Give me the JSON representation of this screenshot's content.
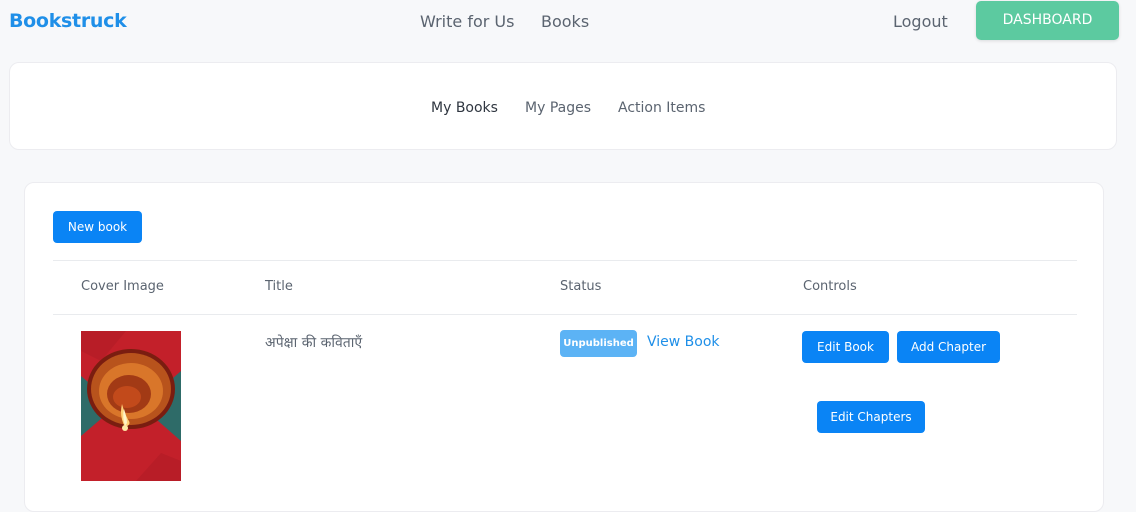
{
  "brand": "Bookstruck",
  "nav": {
    "write_for_us": "Write for Us",
    "books": "Books",
    "logout": "Logout",
    "dashboard": "DASHBOARD"
  },
  "tabs": [
    {
      "label": "My Books",
      "active": true
    },
    {
      "label": "My Pages",
      "active": false
    },
    {
      "label": "Action Items",
      "active": false
    }
  ],
  "new_book_label": "New book",
  "table": {
    "headers": [
      "Cover Image",
      "Title",
      "Status",
      "Controls"
    ],
    "rows": [
      {
        "cover_icon": "diya-lamp-image",
        "title": "अपेक्षा की कविताएँ",
        "status": "Unpublished",
        "view_link": "View Book",
        "controls": [
          "Edit Book",
          "Add Chapter",
          "Edit Chapters"
        ]
      }
    ]
  },
  "colors": {
    "brand": "#1f8fe8",
    "dashboard_button": "#5ccaa0",
    "primary_button": "#0a84f5",
    "status_badge": "#5cb3f5"
  }
}
